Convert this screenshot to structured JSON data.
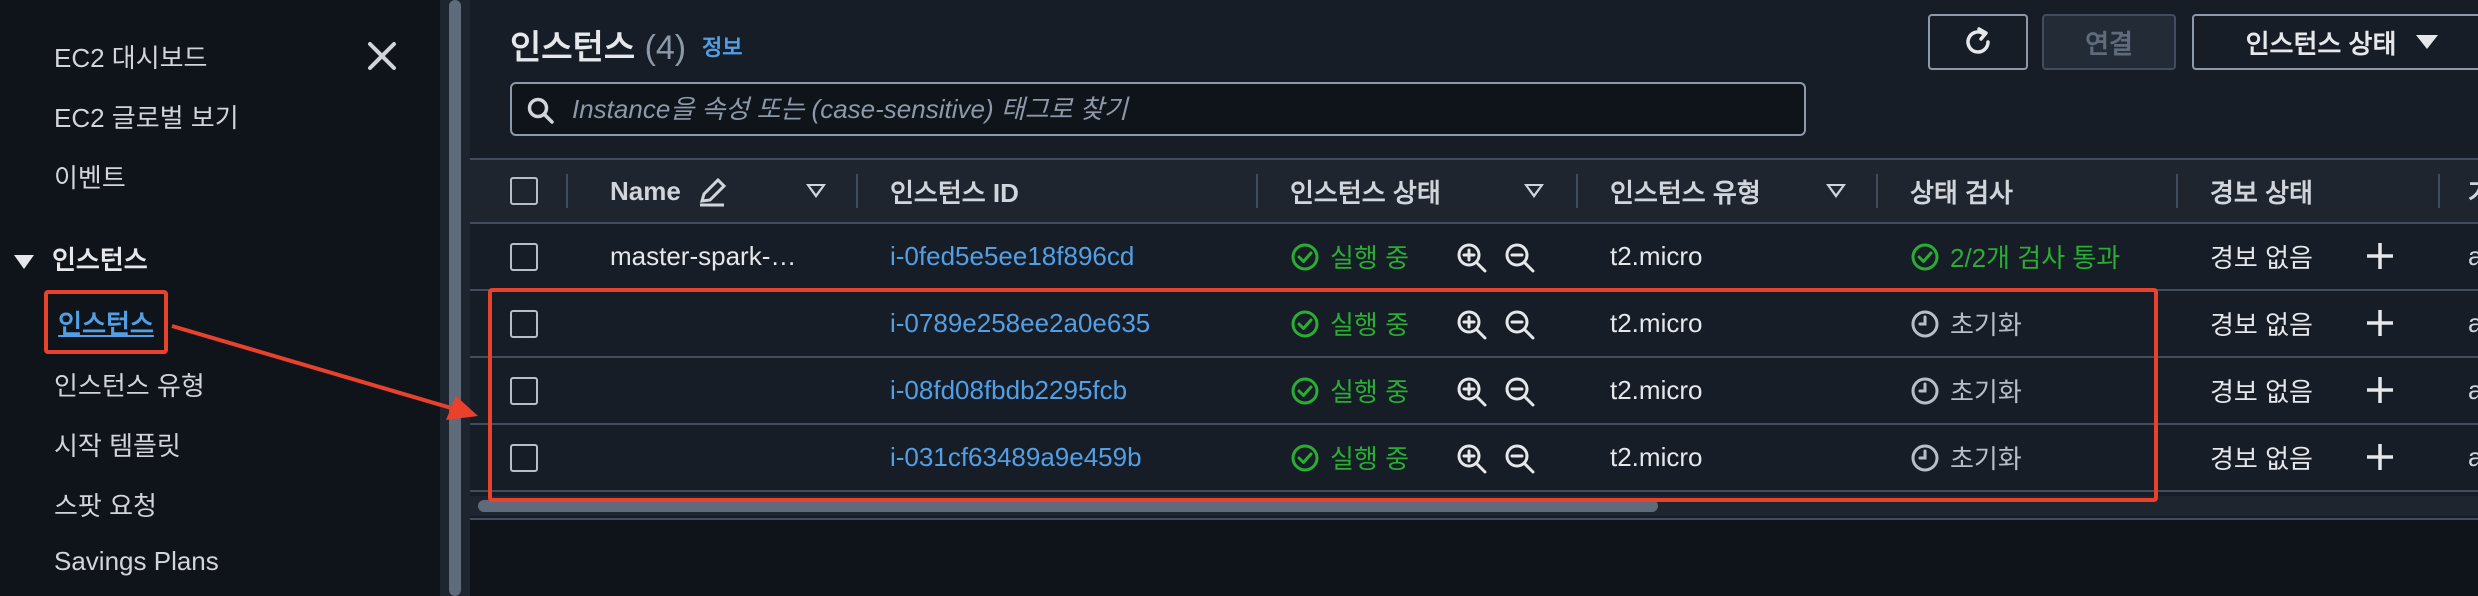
{
  "sidebar": {
    "links": [
      "EC2 대시보드",
      "EC2 글로벌 보기",
      "이벤트"
    ],
    "section_title": "인스턴스",
    "active_item": "인스턴스",
    "sub_items": [
      "인스턴스 유형",
      "시작 템플릿",
      "스팟 요청",
      "Savings Plans"
    ]
  },
  "header": {
    "title": "인스턴스",
    "count": "(4)",
    "info_link": "정보",
    "connect_label": "연결",
    "state_label": "인스턴스 상태"
  },
  "search": {
    "placeholder": "Instance을 속성 또는 (case-sensitive) 태그로 찾기"
  },
  "table": {
    "columns": [
      "Name",
      "인스턴스 ID",
      "인스턴스 상태",
      "인스턴스 유형",
      "상태 검사",
      "경보 상태",
      "가"
    ],
    "rows": [
      {
        "name": "master-spark-…",
        "id": "i-0fed5e5ee18f896cd",
        "state": "실행 중",
        "type": "t2.micro",
        "check": "2/2개 검사 통과",
        "check_kind": "passed",
        "alarm": "경보 없음",
        "cut": "a"
      },
      {
        "name": "",
        "id": "i-0789e258ee2a0e635",
        "state": "실행 중",
        "type": "t2.micro",
        "check": "초기화",
        "check_kind": "init",
        "alarm": "경보 없음",
        "cut": "a"
      },
      {
        "name": "",
        "id": "i-08fd08fbdb2295fcb",
        "state": "실행 중",
        "type": "t2.micro",
        "check": "초기화",
        "check_kind": "init",
        "alarm": "경보 없음",
        "cut": "a"
      },
      {
        "name": "",
        "id": "i-031cf63489a9e459b",
        "state": "실행 중",
        "type": "t2.micro",
        "check": "초기화",
        "check_kind": "init",
        "alarm": "경보 없음",
        "cut": "a"
      }
    ]
  },
  "colors": {
    "link": "#539fe5",
    "success": "#29ad32",
    "annotation": "#e8412c",
    "background": "#161d26"
  },
  "icons": [
    "close-icon",
    "caret-down-icon",
    "refresh-icon",
    "search-icon",
    "edit-icon",
    "sort-icon",
    "check-circle-icon",
    "zoom-in-icon",
    "zoom-out-icon",
    "clock-icon",
    "plus-icon"
  ]
}
